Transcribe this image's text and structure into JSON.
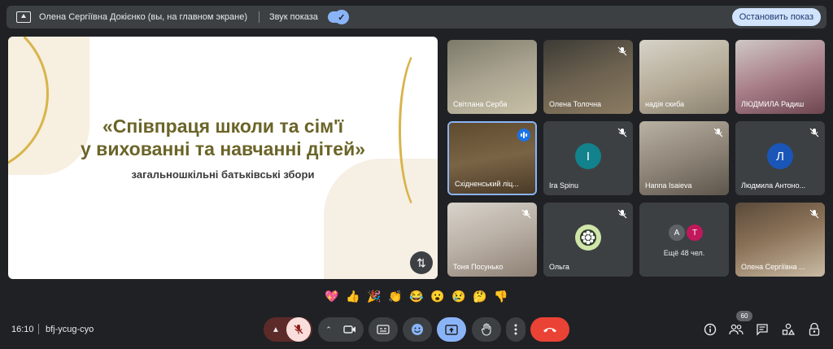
{
  "top_bar": {
    "presenter_text": "Олена Сергіївна Докієнко (вы, на главном экране)",
    "sound_label": "Звук показа",
    "sound_toggle_on": true,
    "stop_label": "Остановить показ"
  },
  "slide": {
    "title_line1": "«Співпраця школи та сім'ї",
    "title_line2": "у вихованні та навчанні дітей»",
    "subtitle": "загальношкільні батьківські збори"
  },
  "participants": [
    {
      "name": "Світлана Серба",
      "muted": false,
      "type": "video"
    },
    {
      "name": "Олена Толочна",
      "muted": true,
      "type": "video"
    },
    {
      "name": "надія скиба",
      "muted": false,
      "type": "video"
    },
    {
      "name": "ЛЮДМИЛА Радиш",
      "muted": false,
      "type": "video"
    },
    {
      "name": "Східненський ліц...",
      "muted": false,
      "type": "video",
      "speaking": true
    },
    {
      "name": "Ira Spinu",
      "muted": true,
      "type": "avatar",
      "initial": "I",
      "color": "#12828c"
    },
    {
      "name": "Hanna Isaieva",
      "muted": true,
      "type": "video"
    },
    {
      "name": "Людмила Антоно...",
      "muted": true,
      "type": "avatar",
      "initial": "Л",
      "color": "#1a56b8"
    },
    {
      "name": "Тоня Посунько",
      "muted": true,
      "type": "video"
    },
    {
      "name": "Ольга",
      "muted": true,
      "type": "logo"
    },
    {
      "more_label": "Ещё 48 чел.",
      "initials": [
        "A",
        "T"
      ],
      "colors": [
        "#5f6368",
        "#c2185b"
      ]
    },
    {
      "name": "Олена Сергіївна ...",
      "muted": true,
      "type": "video"
    }
  ],
  "reactions": [
    "💖",
    "👍",
    "🎉",
    "👏",
    "😂",
    "😮",
    "😢",
    "🤔",
    "👎"
  ],
  "bottom": {
    "time": "16:10",
    "meeting_code": "bfj-ycug-cyo",
    "participants_count": "60"
  },
  "colors": {
    "background": "#202124",
    "accent": "#8ab4f8",
    "end_call": "#ea4335",
    "mic_off": "#f9dedc"
  }
}
